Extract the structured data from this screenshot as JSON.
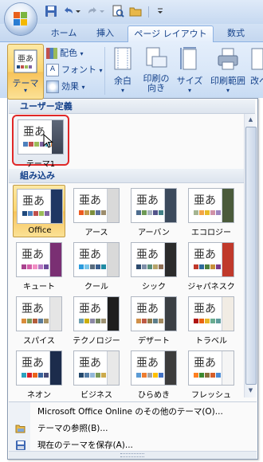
{
  "tabs": [
    {
      "label": "ホーム",
      "active": false
    },
    {
      "label": "挿入",
      "active": false
    },
    {
      "label": "ページ レイアウト",
      "active": true
    },
    {
      "label": "数式",
      "active": false
    }
  ],
  "ribbon": {
    "themes_label": "テーマ",
    "colors_label": "配色",
    "fonts_label": "フォント",
    "effects_label": "効果",
    "margins_label": "余白",
    "orientation_label_1": "印刷の",
    "orientation_label_2": "向き",
    "size_label": "サイズ",
    "print_area_label": "印刷範囲",
    "breaks_label": "改ペ"
  },
  "gallery": {
    "custom_header": "ユーザー定義",
    "builtin_header": "組み込み",
    "custom_themes": [
      {
        "name": "テーマ1"
      }
    ],
    "thumb_text": "亜あ",
    "builtin_themes": [
      {
        "name": "Office",
        "selected": true,
        "colors": [
          "#1f497d",
          "#4f81bd",
          "#c0504d",
          "#9bbb59",
          "#8064a2",
          "#4bacc6"
        ],
        "deco": "#1f3763"
      },
      {
        "name": "アース",
        "selected": false,
        "colors": [
          "#ed5a20",
          "#c39a4e",
          "#7e8f3d",
          "#5b6f9a",
          "#9c8c6c",
          "#5a3c2c"
        ],
        "deco": "#d9d9d9"
      },
      {
        "name": "アーバン",
        "selected": false,
        "colors": [
          "#4e6d8f",
          "#6e9a55",
          "#a7b3bf",
          "#53548a",
          "#438086",
          "#a04da3"
        ],
        "deco": "#3c4a5c"
      },
      {
        "name": "エコロジー",
        "selected": false,
        "colors": [
          "#a5b592",
          "#f3a447",
          "#e7bc29",
          "#d092a7",
          "#9c85c0",
          "#809ec2"
        ],
        "deco": "#4a5a3a"
      },
      {
        "name": "キュート",
        "selected": false,
        "colors": [
          "#a9448f",
          "#d35ea8",
          "#f28fc4",
          "#b57ac4",
          "#6b4c9a",
          "#4b2d6d"
        ],
        "deco": "#7a2f73"
      },
      {
        "name": "クール",
        "selected": false,
        "colors": [
          "#2b9bdd",
          "#79c5ea",
          "#5a6c7d",
          "#3a5f8f",
          "#1f8ba4",
          "#91a8bd"
        ],
        "deco": "#d9d9d9"
      },
      {
        "name": "シック",
        "selected": false,
        "colors": [
          "#2d4b6e",
          "#7f8fa9",
          "#5a8f7b",
          "#b6a46a",
          "#8e6f57",
          "#666666"
        ],
        "deco": "#2b2b2b"
      },
      {
        "name": "ジャパネスク",
        "selected": false,
        "colors": [
          "#c0392b",
          "#2e6b9b",
          "#4d7f3c",
          "#c7903a",
          "#7b3c8a",
          "#333333"
        ],
        "deco": "#c0392b"
      },
      {
        "name": "スパイス",
        "selected": false,
        "colors": [
          "#d98d3b",
          "#7e9b5a",
          "#b35d3b",
          "#5b7c99",
          "#a99465",
          "#68483b"
        ],
        "deco": "#e5e5e5"
      },
      {
        "name": "テクノロジー",
        "selected": false,
        "colors": [
          "#6ea0b0",
          "#ccaf0a",
          "#8d89a4",
          "#748560",
          "#9e9273",
          "#7e848d"
        ],
        "deco": "#1e1e1e"
      },
      {
        "name": "デザート",
        "selected": false,
        "colors": [
          "#d19049",
          "#bf5b45",
          "#8e7d4d",
          "#5d7e8b",
          "#a38b61",
          "#744d3b"
        ],
        "deco": "#3b3f44"
      },
      {
        "name": "トラベル",
        "selected": false,
        "colors": [
          "#b01513",
          "#ea6312",
          "#e6b729",
          "#6aac90",
          "#5f9c9d",
          "#9e5e9b"
        ],
        "deco": "#f1ece4"
      },
      {
        "name": "ネオン",
        "selected": false,
        "colors": [
          "#2da2bf",
          "#da1f28",
          "#eb641b",
          "#39639d",
          "#474b78",
          "#7d3c4a"
        ],
        "deco": "#1c2c4c"
      },
      {
        "name": "ビジネス",
        "selected": false,
        "colors": [
          "#24486c",
          "#547da6",
          "#92b7d9",
          "#7a9a5a",
          "#ccaa4c",
          "#6b5c8c"
        ],
        "deco": "#e8e8e8"
      },
      {
        "name": "ひらめき",
        "selected": false,
        "colors": [
          "#5b9bd5",
          "#ed7d31",
          "#a5a5a5",
          "#ffc000",
          "#4472c4",
          "#70ad47"
        ],
        "deco": "#3c3c3c"
      },
      {
        "name": "フレッシュ",
        "selected": false,
        "colors": [
          "#ff8021",
          "#3b8a2f",
          "#8b6f3c",
          "#d55f2a",
          "#4a8ad3",
          "#9c4f2a"
        ],
        "deco": "#f5f5f5"
      }
    ]
  },
  "menu": [
    {
      "label": "Microsoft Office Online のその他のテーマ(O)...",
      "icon": "blank-icon"
    },
    {
      "label": "テーマの参照(B)...",
      "icon": "folder-icon"
    },
    {
      "label": "現在のテーマを保存(A)...",
      "icon": "save-icon"
    }
  ],
  "colors": {
    "accent": "#15428b",
    "highlight_border": "#e02828",
    "selected_fill": "#fbd56c"
  }
}
